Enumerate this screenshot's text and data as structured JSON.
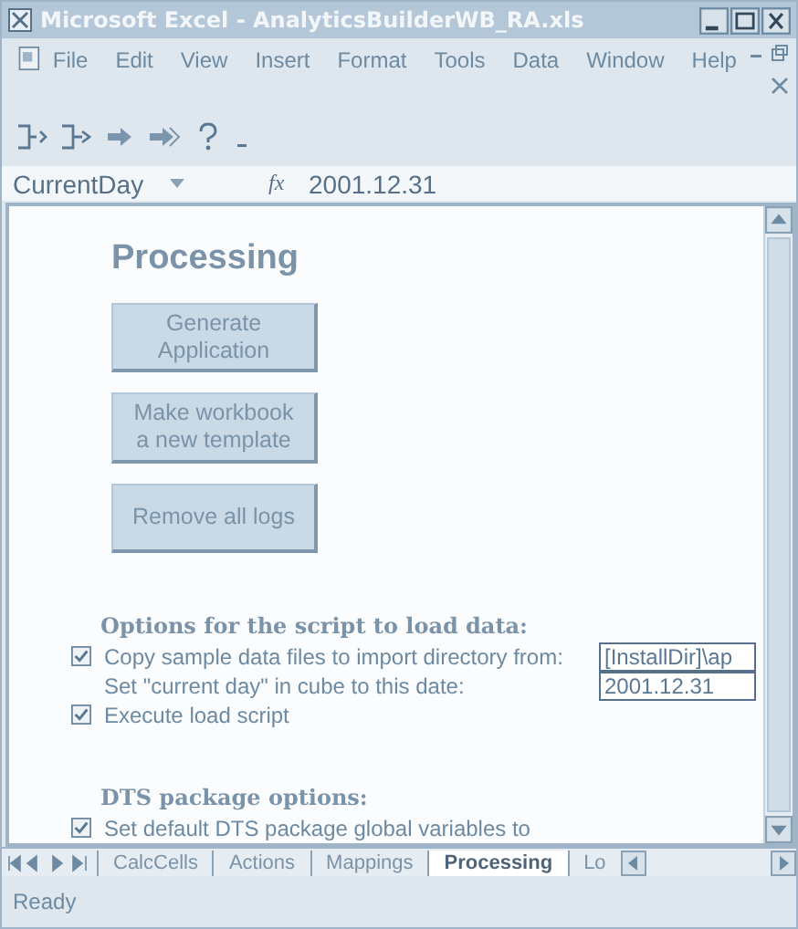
{
  "window": {
    "title": "Microsoft Excel - AnalyticsBuilderWB_RA.xls"
  },
  "menu": [
    {
      "label": "File"
    },
    {
      "label": "Edit"
    },
    {
      "label": "View"
    },
    {
      "label": "Insert"
    },
    {
      "label": "Format"
    },
    {
      "label": "Tools"
    },
    {
      "label": "Data"
    },
    {
      "label": "Window"
    },
    {
      "label": "Help"
    }
  ],
  "formula_bar": {
    "name_box": "CurrentDay",
    "fx": "fx",
    "value": "2001.12.31"
  },
  "sheet": {
    "heading": "Processing",
    "buttons": [
      {
        "label": "Generate Application"
      },
      {
        "label": "Make workbook a new template"
      },
      {
        "label": "Remove all logs"
      }
    ],
    "sections": [
      {
        "heading": "Options for the script to load data:",
        "options": [
          {
            "kind": "checkbox",
            "label": "Copy sample data files to import directory from:",
            "checked": true,
            "field": "[InstallDir]\\ap"
          },
          {
            "kind": "plain",
            "label": "Set \"current day\" in cube to this date:",
            "field": "2001.12.31"
          },
          {
            "kind": "checkbox",
            "label": "Execute load script",
            "checked": true
          }
        ]
      },
      {
        "heading": "DTS package options:",
        "options": [
          {
            "kind": "checkbox",
            "label": "Set default DTS package global variables to",
            "checked": true
          }
        ]
      }
    ]
  },
  "sheet_tabs": [
    {
      "label": "CalcCells",
      "selected": false
    },
    {
      "label": "Actions",
      "selected": false
    },
    {
      "label": "Mappings",
      "selected": false
    },
    {
      "label": "Processing",
      "selected": true
    },
    {
      "label": "Lo",
      "selected": false
    }
  ],
  "status_bar": {
    "text": "Ready"
  }
}
